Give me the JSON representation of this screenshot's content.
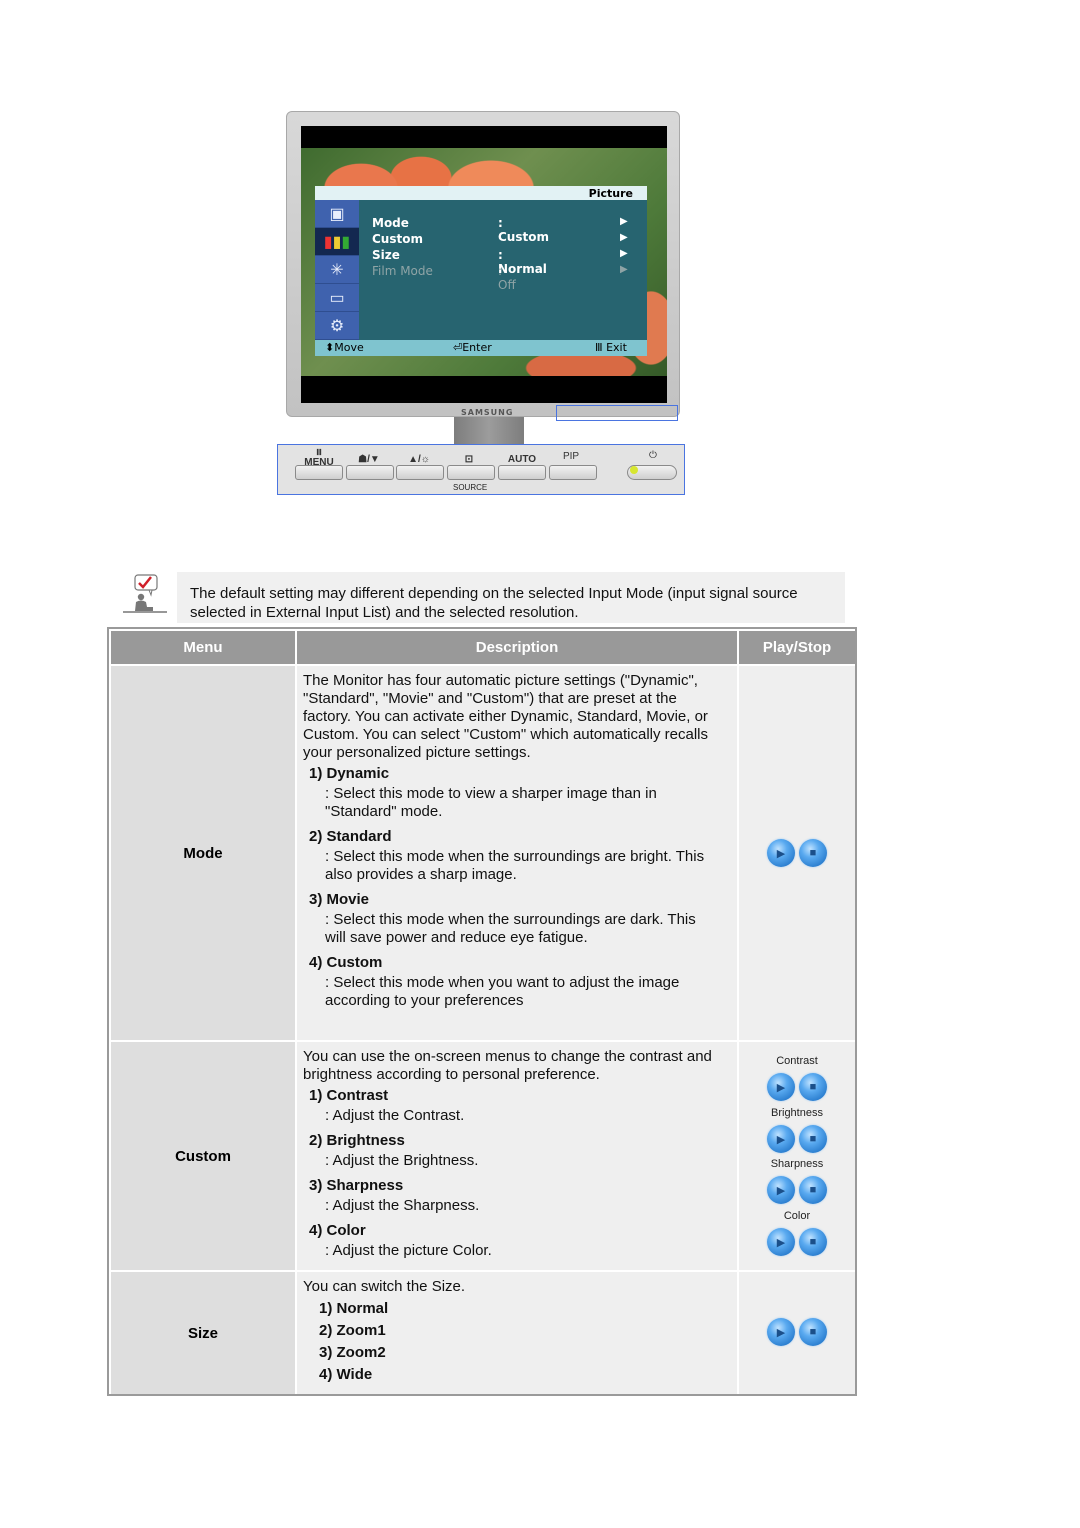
{
  "monitor": {
    "osd": {
      "title": "Picture",
      "rows": [
        {
          "label": "Mode",
          "value": ": Custom",
          "arrow": "▶",
          "enabled": true
        },
        {
          "label": "Custom",
          "value": "",
          "arrow": "▶",
          "enabled": true
        },
        {
          "label": "Size",
          "value": ": Normal",
          "arrow": "▶",
          "enabled": true
        },
        {
          "label": "Film Mode",
          "value": ": Off",
          "arrow": "▶",
          "enabled": false
        }
      ],
      "side_icons": [
        "input-icon",
        "picture-icon",
        "effect-icon",
        "pip-icon",
        "setup-icon"
      ],
      "footer": {
        "move": "⬍Move",
        "enter": "⏎Enter",
        "exit": "Ⅲ Exit"
      }
    },
    "brand": "SAMSUNG"
  },
  "control_panel": {
    "buttons": [
      {
        "label": "MENU",
        "icon": "menu-icon"
      },
      {
        "label": "☗/▼",
        "icon": "magicbright-down-icon"
      },
      {
        "label": "▲/☼",
        "icon": "up-brightness-icon"
      },
      {
        "label": "⊡",
        "icon": "source-enter-icon"
      },
      {
        "label": "AUTO",
        "icon": ""
      },
      {
        "label": "PIP",
        "icon": ""
      },
      {
        "label": "⏻",
        "icon": "power-icon"
      }
    ],
    "source_label": "SOURCE"
  },
  "note": {
    "text": "The default setting may different depending on the selected Input Mode (input signal source selected in External Input List) and the selected resolution."
  },
  "table": {
    "headers": {
      "menu": "Menu",
      "description": "Description",
      "play": "Play/Stop"
    },
    "rows": [
      {
        "menu": "Mode",
        "intro": "The Monitor has four automatic picture settings (\"Dynamic\", \"Standard\", \"Movie\" and \"Custom\") that are preset at the factory. You can activate either Dynamic, Standard, Movie, or Custom. You can select \"Custom\" which automatically recalls your personalized picture settings.",
        "items": [
          {
            "title": "1) Dynamic",
            "desc": ": Select this mode to view a sharper image than in \"Standard\" mode."
          },
          {
            "title": "2) Standard",
            "desc": ": Select this mode when the surroundings are bright. This also provides a sharp image."
          },
          {
            "title": "3) Movie",
            "desc": ": Select this mode when the surroundings are dark. This will save power and reduce eye fatigue."
          },
          {
            "title": "4) Custom",
            "desc": ": Select this mode when you want to adjust the image according to your preferences"
          }
        ]
      },
      {
        "menu": "Custom",
        "intro": "You can use the on-screen menus to change the contrast and brightness according to personal preference.",
        "items": [
          {
            "title": "1) Contrast",
            "desc": ": Adjust the Contrast."
          },
          {
            "title": "2) Brightness",
            "desc": ": Adjust the Brightness."
          },
          {
            "title": "3) Sharpness",
            "desc": ": Adjust the Sharpness."
          },
          {
            "title": "4) Color",
            "desc": ": Adjust the picture Color."
          }
        ],
        "play_labels": [
          "Contrast",
          "Brightness",
          "Sharpness",
          "Color"
        ]
      },
      {
        "menu": "Size",
        "intro": "You can switch the Size.",
        "items": [
          {
            "title": "1) Normal"
          },
          {
            "title": "2) Zoom1"
          },
          {
            "title": "3) Zoom2"
          },
          {
            "title": "4) Wide"
          }
        ]
      }
    ]
  }
}
